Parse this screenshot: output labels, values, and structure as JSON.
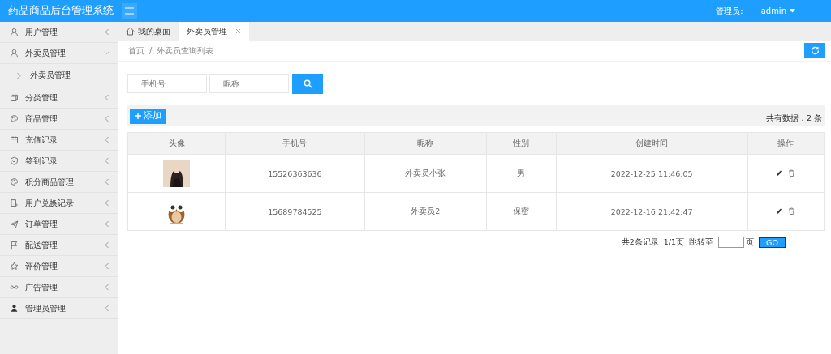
{
  "header": {
    "title": "药品商品后台管理系统",
    "admin_label": "管理员:",
    "admin_name": "admin"
  },
  "sidebar": {
    "items": [
      {
        "label": "用户管理",
        "expanded": false
      },
      {
        "label": "外卖员管理",
        "expanded": true,
        "children": [
          {
            "label": "外卖员管理"
          }
        ]
      },
      {
        "label": "分类管理",
        "expanded": false
      },
      {
        "label": "商品管理",
        "expanded": false
      },
      {
        "label": "充值记录",
        "expanded": false
      },
      {
        "label": "签到记录",
        "expanded": false
      },
      {
        "label": "积分商品管理",
        "expanded": false
      },
      {
        "label": "用户兑换记录",
        "expanded": false
      },
      {
        "label": "订单管理",
        "expanded": false
      },
      {
        "label": "配送管理",
        "expanded": false
      },
      {
        "label": "评价管理",
        "expanded": false
      },
      {
        "label": "广告管理",
        "expanded": false
      },
      {
        "label": "管理员管理",
        "expanded": false
      }
    ]
  },
  "tabs": [
    {
      "label": "我的桌面",
      "kind": "home",
      "selected": false
    },
    {
      "label": "外卖员管理",
      "kind": "closable",
      "selected": true
    }
  ],
  "breadcrumb": [
    "首页",
    "/",
    "外卖员查询列表"
  ],
  "search": {
    "fields": [
      {
        "placeholder": "手机号"
      },
      {
        "placeholder": "昵称"
      }
    ]
  },
  "toolbar": {
    "add_button": "添加",
    "total": "共有数据：2 条"
  },
  "table": {
    "columns": [
      "头像",
      "手机号",
      "昵称",
      "性别",
      "创建时间",
      "操作"
    ],
    "rows": [
      {
        "phone": "15526363636",
        "nickname": "外卖员小张",
        "gender": "男",
        "created": "2022-12-25 11:46:05"
      },
      {
        "phone": "15689784525",
        "nickname": "外卖员2",
        "gender": "保密",
        "created": "2022-12-16 21:42:47"
      }
    ]
  },
  "pagination": {
    "records": "共2条记录",
    "pages": "1/1页",
    "jump_label": "跳转至",
    "page_unit": "页",
    "go": "GO"
  }
}
